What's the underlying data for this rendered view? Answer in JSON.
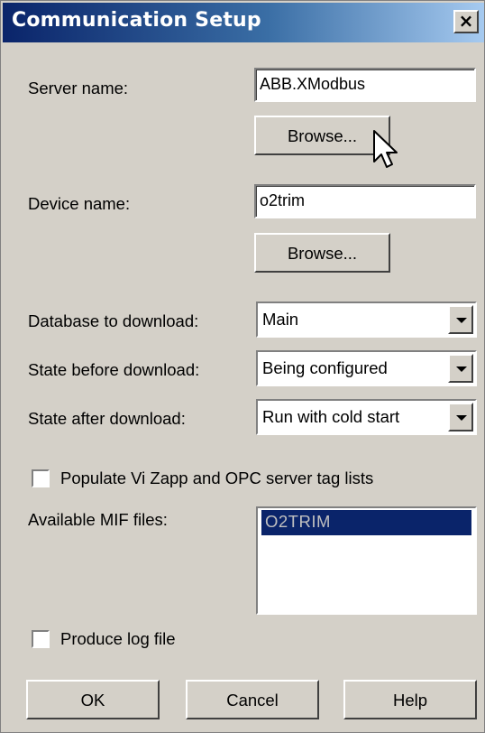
{
  "window": {
    "title": "Communication Setup",
    "close_label": "×"
  },
  "server": {
    "label": "Server name:",
    "value": "ABB.XModbus",
    "browse_label": "Browse..."
  },
  "device": {
    "label": "Device name:",
    "value": "o2trim",
    "browse_label": "Browse..."
  },
  "database": {
    "label": "Database to download:",
    "selected": "Main"
  },
  "state_before": {
    "label": "State before download:",
    "selected": "Being configured"
  },
  "state_after": {
    "label": "State after download:",
    "selected": "Run with cold start"
  },
  "populate": {
    "label": "Populate Vi Zapp and OPC server tag lists",
    "checked": false
  },
  "mif": {
    "label": "Available MIF files:",
    "items": [
      "O2TRIM"
    ]
  },
  "log": {
    "label": "Produce log file",
    "checked": false
  },
  "buttons": {
    "ok": "OK",
    "cancel": "Cancel",
    "help": "Help"
  },
  "icons": {
    "close": "close-icon",
    "dropdown": "chevron-down-icon",
    "cursor": "mouse-pointer-icon"
  }
}
